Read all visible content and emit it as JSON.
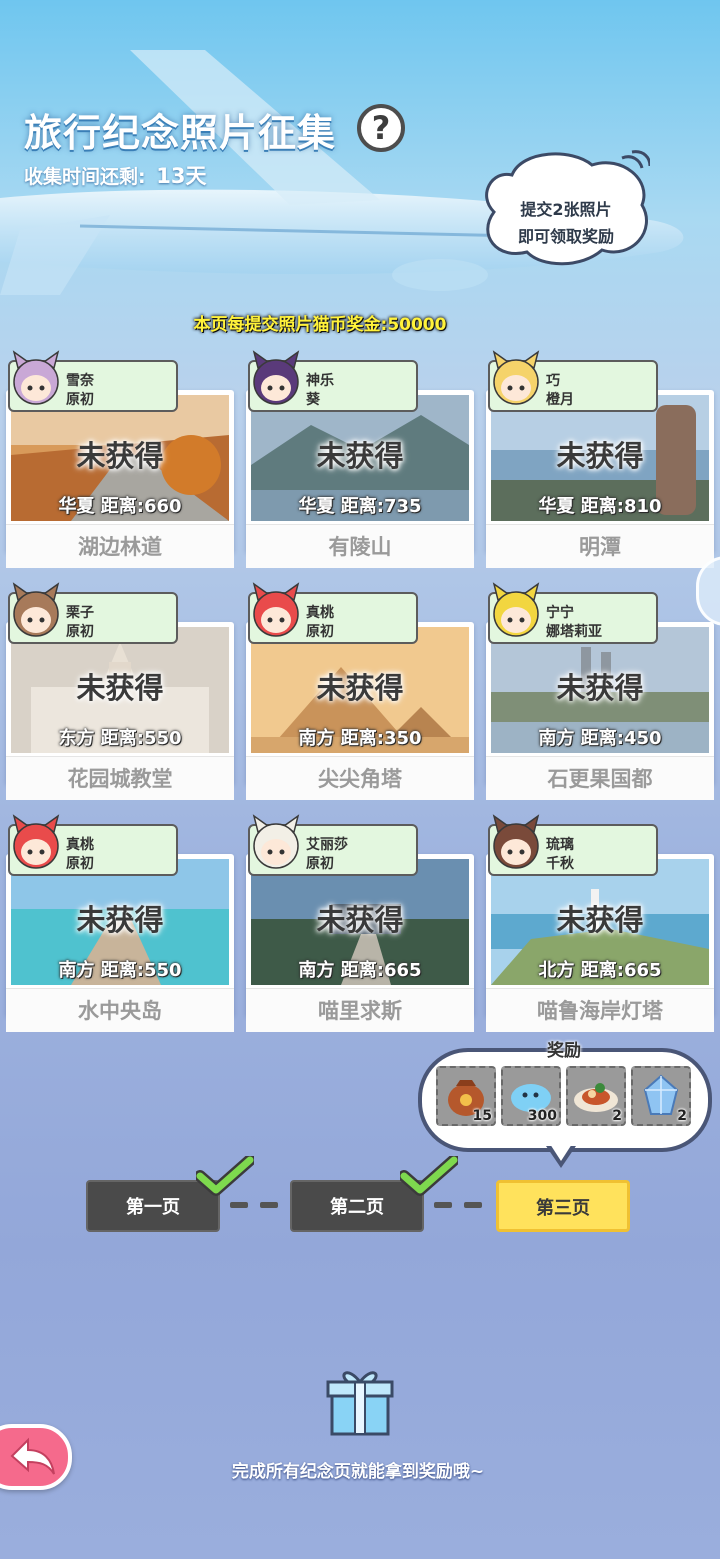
{
  "header": {
    "title": "旅行纪念照片征集",
    "help_label": "?",
    "timer_label": "收集时间还剩:",
    "timer_value": "13天"
  },
  "speech_bubble": {
    "line1": "提交2张照片",
    "line2": "即可领取奖励"
  },
  "bonus_text": "本页每提交照片猫币奖金:50000",
  "locked_label": "未获得",
  "cards": [
    {
      "char1": "雪奈",
      "char2": "原初",
      "region": "华夏",
      "distance": "距离:660",
      "location": "湖边林道",
      "photo": "autumn-path",
      "avatar_color": "#c9a8d6"
    },
    {
      "char1": "神乐",
      "char2": "葵",
      "region": "华夏",
      "distance": "距离:735",
      "location": "有陵山",
      "photo": "mountain-lake",
      "avatar_color": "#5a3a7a"
    },
    {
      "char1": "巧",
      "char2": "橙月",
      "region": "华夏",
      "distance": "距离:810",
      "location": "明潭",
      "photo": "lake-rock",
      "avatar_color": "#f5d36a"
    },
    {
      "char1": "栗子",
      "char2": "原初",
      "region": "东方",
      "distance": "距离:550",
      "location": "花园城教堂",
      "photo": "church",
      "avatar_color": "#a77a5a"
    },
    {
      "char1": "真桃",
      "char2": "原初",
      "region": "南方",
      "distance": "距离:350",
      "location": "尖尖角塔",
      "photo": "pyramid",
      "avatar_color": "#e94b4b"
    },
    {
      "char1": "宁宁",
      "char2": "娜塔莉亚",
      "region": "南方",
      "distance": "距离:450",
      "location": "石更果国都",
      "photo": "city-river",
      "avatar_color": "#f2d640"
    },
    {
      "char1": "真桃",
      "char2": "原初",
      "region": "南方",
      "distance": "距离:550",
      "location": "水中央岛",
      "photo": "pier-sea",
      "avatar_color": "#e94b4b"
    },
    {
      "char1": "艾丽莎",
      "char2": "原初",
      "region": "南方",
      "distance": "距离:665",
      "location": "喵里求斯",
      "photo": "resort",
      "avatar_color": "#f2efe6"
    },
    {
      "char1": "琉璃",
      "char2": "千秋",
      "region": "北方",
      "distance": "距离:665",
      "location": "喵鲁海岸灯塔",
      "photo": "coast-lighthouse",
      "avatar_color": "#7a4a3a"
    }
  ],
  "rewards": {
    "title": "奖励",
    "items": [
      {
        "icon": "coin-bag-icon",
        "count": "15"
      },
      {
        "icon": "blue-slime-icon",
        "count": "300"
      },
      {
        "icon": "food-plate-icon",
        "count": "2"
      },
      {
        "icon": "crystal-icon",
        "count": "2"
      }
    ]
  },
  "pages": [
    {
      "label": "第一页",
      "state": "done"
    },
    {
      "label": "第二页",
      "state": "done"
    },
    {
      "label": "第三页",
      "state": "active"
    }
  ],
  "footer_text": "完成所有纪念页就能拿到奖励哦~",
  "colors": {
    "accent_yellow": "#ffe25c",
    "tag_green": "#e3f7df",
    "back_pink": "#f56a8c",
    "check_green": "#7ed94e"
  }
}
